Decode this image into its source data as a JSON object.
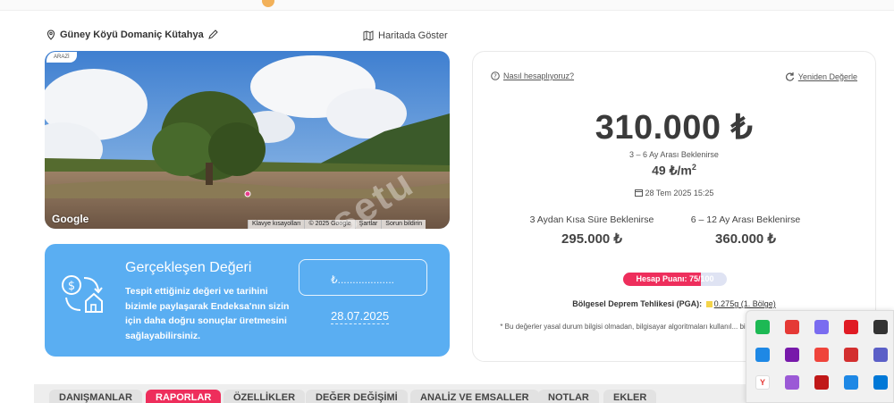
{
  "location": {
    "text": "Güney Köyü Domaniç Kütahya",
    "map_link": "Haritada Göster"
  },
  "photo": {
    "tag": "ARAZİ",
    "provider_logo": "Google",
    "credits": [
      "Klavye kısayolları",
      "© 2025 Google",
      "Şartlar",
      "Sorun bildirin"
    ]
  },
  "realized": {
    "title": "Gerçekleşen Değeri",
    "description": "Tespit ettiğiniz değeri ve tarihini bizimle paylaşarak Endeksa'nın sizin için daha doğru sonuçlar üretmesini sağlayabilirsiniz.",
    "input_placeholder": "₺...................",
    "date": "28.07.2025"
  },
  "valuation": {
    "how_link": "Nasıl hesaplıyoruz?",
    "recalc_link": "Yeniden Değerle",
    "price": "310.000 ₺",
    "expectation": "3 – 6 Ay Arası Beklenirse",
    "per_m2": "49 ₺/m",
    "per_m2_sup": "2",
    "timestamp": "28 Tem 2025 15:25",
    "short_label": "3 Aydan Kısa Süre Beklenirse",
    "short_amount": "295.000 ₺",
    "long_label": "6 – 12 Ay Arası Beklenirse",
    "long_amount": "360.000 ₺",
    "score_text": "Hesap Puanı: 75/100",
    "score_value": 75,
    "quake_label": "Bölgesel Deprem Tehlikesi (PGA):",
    "quake_value": "0.275g (1. Bölge)",
    "disclaimer": "* Bu değerler yasal durum bilgisi olmadan, bilgisayar algoritmaları kullanıl... bir yasal yükümlülük taşımamaktadır."
  },
  "watermark": "setu",
  "tabs": [
    "DANIŞMANLAR",
    "RAPORLAR",
    "ÖZELLİKLER",
    "DEĞER DEĞİŞİMİ",
    "ANALİZ VE EMSALLER",
    "NOTLAR",
    "EKLER"
  ],
  "active_tab": "RAPORLAR",
  "colors": {
    "accent": "#ee2e5c",
    "card_blue": "#5aaef2"
  },
  "tray_icons": [
    {
      "name": "spotify-icon",
      "color": "#1db954"
    },
    {
      "name": "app-red-icon",
      "color": "#e53935"
    },
    {
      "name": "copilot-icon",
      "color": "#7a6cf0"
    },
    {
      "name": "opera-icon",
      "color": "#e01b24"
    },
    {
      "name": "chat-icon",
      "color": "#333333"
    },
    {
      "name": "monitor-icon",
      "color": "#1e88e5"
    },
    {
      "name": "onenote-icon",
      "color": "#7719aa"
    },
    {
      "name": "anydesk-icon",
      "color": "#ef443b"
    },
    {
      "name": "app-red2-icon",
      "color": "#d32f2f"
    },
    {
      "name": "teams-icon",
      "color": "#5b5fc7"
    },
    {
      "name": "yandex-icon",
      "color": "#ffffff"
    },
    {
      "name": "feather-icon",
      "color": "#9b59d6"
    },
    {
      "name": "mcafee-icon",
      "color": "#c01818"
    },
    {
      "name": "defender-icon",
      "color": "#1e88e5"
    },
    {
      "name": "bluetooth-icon",
      "color": "#0078d7"
    }
  ]
}
